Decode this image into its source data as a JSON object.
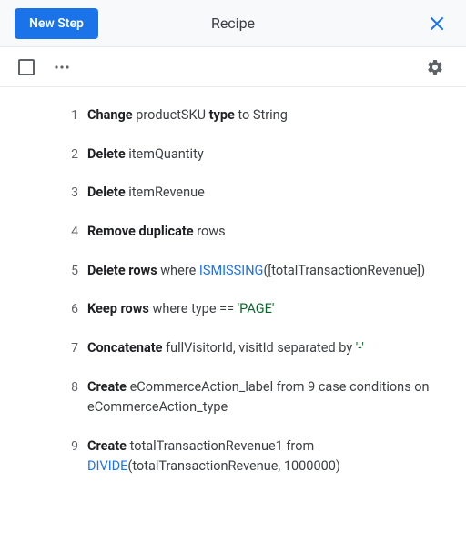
{
  "header": {
    "new_step_label": "New Step",
    "title": "Recipe"
  },
  "steps": [
    {
      "num": "1",
      "tokens": [
        {
          "t": "Change ",
          "cls": "strong"
        },
        {
          "t": "productSKU ",
          "cls": "text"
        },
        {
          "t": "type ",
          "cls": "strong"
        },
        {
          "t": "to String",
          "cls": "text"
        }
      ]
    },
    {
      "num": "2",
      "tokens": [
        {
          "t": "Delete ",
          "cls": "strong"
        },
        {
          "t": "itemQuantity",
          "cls": "text"
        }
      ]
    },
    {
      "num": "3",
      "tokens": [
        {
          "t": "Delete ",
          "cls": "strong"
        },
        {
          "t": "itemRevenue",
          "cls": "text"
        }
      ]
    },
    {
      "num": "4",
      "tokens": [
        {
          "t": "Remove duplicate ",
          "cls": "strong"
        },
        {
          "t": "rows",
          "cls": "text"
        }
      ]
    },
    {
      "num": "5",
      "tokens": [
        {
          "t": "Delete rows ",
          "cls": "strong"
        },
        {
          "t": "where ",
          "cls": "text"
        },
        {
          "t": "ISMISSING",
          "cls": "blue"
        },
        {
          "t": "([totalTransactionRevenue])",
          "cls": "text"
        }
      ]
    },
    {
      "num": "6",
      "tokens": [
        {
          "t": "Keep rows ",
          "cls": "strong"
        },
        {
          "t": "where type == ",
          "cls": "text"
        },
        {
          "t": "'PAGE'",
          "cls": "green"
        }
      ]
    },
    {
      "num": "7",
      "tokens": [
        {
          "t": "Concatenate ",
          "cls": "strong"
        },
        {
          "t": "fullVisitorId, visitId separated by ",
          "cls": "text"
        },
        {
          "t": "'-'",
          "cls": "green"
        }
      ]
    },
    {
      "num": "8",
      "tokens": [
        {
          "t": "Create ",
          "cls": "strong"
        },
        {
          "t": "eCommerceAction_label from 9 case conditions on eCommerceAction_type",
          "cls": "text"
        }
      ]
    },
    {
      "num": "9",
      "tokens": [
        {
          "t": "Create ",
          "cls": "strong"
        },
        {
          "t": "totalTransactionRevenue1 from ",
          "cls": "text"
        },
        {
          "t": "DIVIDE",
          "cls": "blue"
        },
        {
          "t": "(totalTransactionRevenue, 1000000)",
          "cls": "text"
        }
      ]
    }
  ]
}
